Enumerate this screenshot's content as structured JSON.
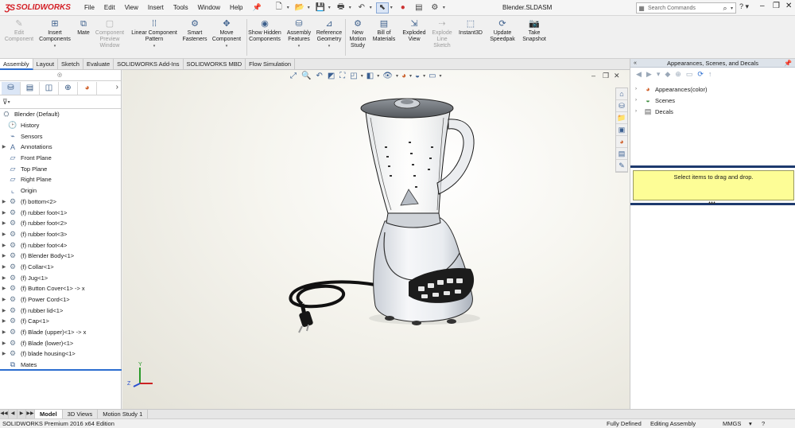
{
  "app": {
    "logo_text": "SOLIDWORKS",
    "menus": [
      "File",
      "Edit",
      "View",
      "Insert",
      "Tools",
      "Window",
      "Help"
    ],
    "document_title": "Blender.SLDASM",
    "search_placeholder": "Search Commands",
    "help_label": "?"
  },
  "command_manager": {
    "buttons": [
      {
        "label": "Edit Component",
        "icon": "edit-component-icon",
        "disabled": true
      },
      {
        "label": "Insert Components",
        "icon": "insert-components-icon",
        "disabled": false
      },
      {
        "label": "Mate",
        "icon": "mate-icon",
        "disabled": false
      },
      {
        "label": "Component Preview Window",
        "icon": "component-preview-icon",
        "disabled": true
      },
      {
        "label": "Linear Component Pattern",
        "icon": "linear-pattern-icon",
        "disabled": false
      },
      {
        "label": "Smart Fasteners",
        "icon": "smart-fasteners-icon",
        "disabled": false
      },
      {
        "label": "Move Component",
        "icon": "move-component-icon",
        "disabled": false
      },
      {
        "label": "Show Hidden Components",
        "icon": "show-hidden-icon",
        "disabled": false
      },
      {
        "label": "Assembly Features",
        "icon": "assembly-features-icon",
        "disabled": false
      },
      {
        "label": "Reference Geometry",
        "icon": "reference-geometry-icon",
        "disabled": false
      },
      {
        "label": "New Motion Study",
        "icon": "motion-study-icon",
        "disabled": false
      },
      {
        "label": "Bill of Materials",
        "icon": "bom-icon",
        "disabled": false
      },
      {
        "label": "Exploded View",
        "icon": "exploded-view-icon",
        "disabled": false
      },
      {
        "label": "Explode Line Sketch",
        "icon": "explode-line-icon",
        "disabled": true
      },
      {
        "label": "Instant3D",
        "icon": "instant3d-icon",
        "disabled": false
      },
      {
        "label": "Update Speedpak",
        "icon": "speedpak-icon",
        "disabled": false
      },
      {
        "label": "Take Snapshot",
        "icon": "snapshot-icon",
        "disabled": false
      }
    ]
  },
  "tabs": [
    "Assembly",
    "Layout",
    "Sketch",
    "Evaluate",
    "SOLIDWORKS Add-Ins",
    "SOLIDWORKS MBD",
    "Flow Simulation"
  ],
  "active_tab": "Assembly",
  "feature_tree": {
    "root": "Blender  (Default)",
    "items": [
      {
        "label": "History",
        "icon": "history-icon",
        "expandable": false
      },
      {
        "label": "Sensors",
        "icon": "sensors-icon",
        "expandable": false
      },
      {
        "label": "Annotations",
        "icon": "annotations-icon",
        "expandable": true
      },
      {
        "label": "Front Plane",
        "icon": "plane-icon",
        "expandable": false
      },
      {
        "label": "Top Plane",
        "icon": "plane-icon",
        "expandable": false
      },
      {
        "label": "Right Plane",
        "icon": "plane-icon",
        "expandable": false
      },
      {
        "label": "Origin",
        "icon": "origin-icon",
        "expandable": false
      },
      {
        "label": "(f) bottom<2>",
        "icon": "part-icon",
        "expandable": true
      },
      {
        "label": "(f) rubber foot<1>",
        "icon": "part-icon",
        "expandable": true
      },
      {
        "label": "(f) rubber foot<2>",
        "icon": "part-icon",
        "expandable": true
      },
      {
        "label": "(f) rubber foot<3>",
        "icon": "part-icon",
        "expandable": true
      },
      {
        "label": "(f) rubber foot<4>",
        "icon": "part-icon",
        "expandable": true
      },
      {
        "label": "(f) Blender Body<1>",
        "icon": "part-icon",
        "expandable": true
      },
      {
        "label": "(f) Collar<1>",
        "icon": "part-icon",
        "expandable": true
      },
      {
        "label": "(f) Jug<1>",
        "icon": "part-icon",
        "expandable": true
      },
      {
        "label": "(f) Button Cover<1> -> x",
        "icon": "part-icon",
        "expandable": true
      },
      {
        "label": "(f) Power Cord<1>",
        "icon": "part-icon",
        "expandable": true
      },
      {
        "label": "(f) rubber lid<1>",
        "icon": "part-icon",
        "expandable": true
      },
      {
        "label": "(f) Cap<1>",
        "icon": "part-icon",
        "expandable": true
      },
      {
        "label": "(f) Blade (upper)<1> -> x",
        "icon": "part-icon",
        "expandable": true
      },
      {
        "label": "(f) Blade (lower)<1>",
        "icon": "part-icon",
        "expandable": true
      },
      {
        "label": "(f) blade housing<1>",
        "icon": "part-icon",
        "expandable": true
      },
      {
        "label": "Mates",
        "icon": "mates-icon",
        "expandable": false
      }
    ]
  },
  "task_pane": {
    "title": "Appearances, Scenes, and Decals",
    "items": [
      {
        "label": "Appearances(color)",
        "icon": "appearances-icon"
      },
      {
        "label": "Scenes",
        "icon": "scenes-icon"
      },
      {
        "label": "Decals",
        "icon": "decals-icon"
      }
    ],
    "drop_hint": "Select items to drag and drop."
  },
  "bottom_tabs": [
    "Model",
    "3D Views",
    "Motion Study 1"
  ],
  "active_bottom_tab": "Model",
  "status": {
    "edition": "SOLIDWORKS Premium 2016 x64 Edition",
    "definition": "Fully Defined",
    "mode": "Editing Assembly",
    "units": "MMGS"
  },
  "colors": {
    "brand_red": "#d42027",
    "accent_blue": "#2c6ed0",
    "drop_hint_bg": "#fdfd96"
  }
}
